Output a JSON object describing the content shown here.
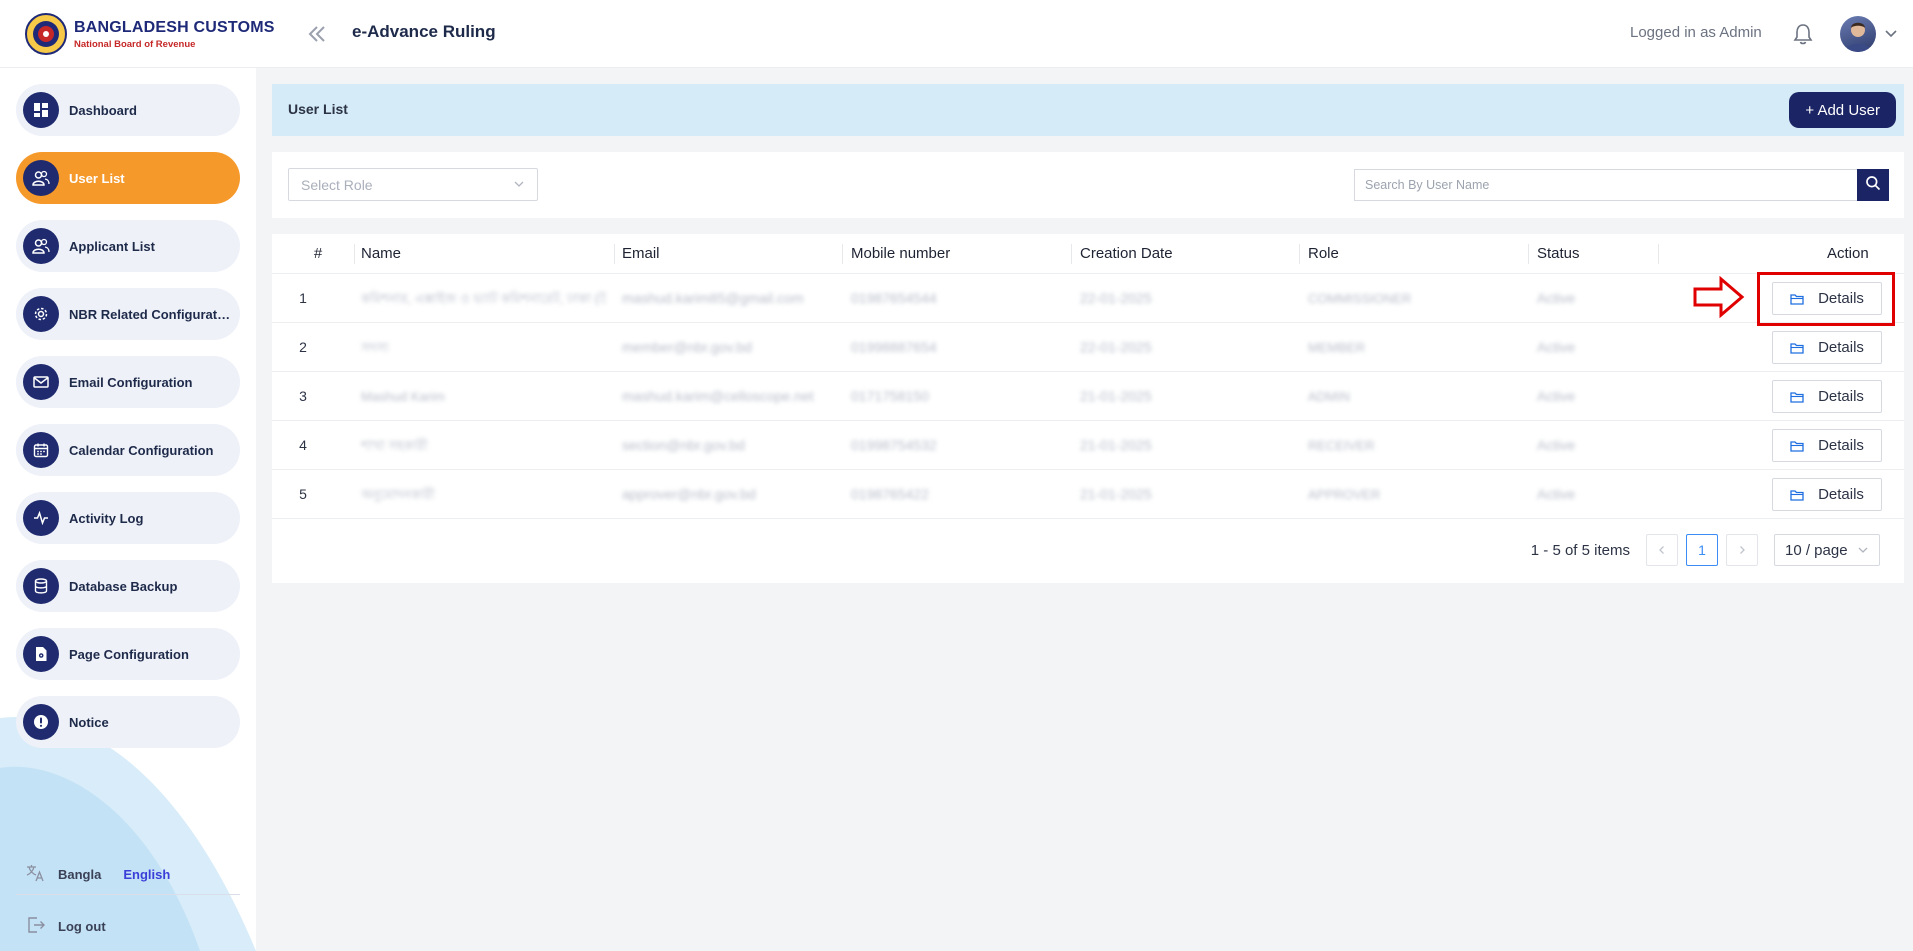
{
  "brand": {
    "title": "BANGLADESH CUSTOMS",
    "subtitle": "National Board of Revenue"
  },
  "header": {
    "app_title": "e-Advance Ruling",
    "logged_in_text": "Logged in as Admin",
    "collapse_icon": "double-chevron-left-icon"
  },
  "sidebar": {
    "items": [
      {
        "label": "Dashboard",
        "icon": "dashboard-icon",
        "active": false
      },
      {
        "label": "User List",
        "icon": "users-icon",
        "active": true
      },
      {
        "label": "Applicant List",
        "icon": "users-icon",
        "active": false
      },
      {
        "label": "NBR Related Configurati...",
        "icon": "gear-icon",
        "active": false
      },
      {
        "label": "Email Configuration",
        "icon": "mail-icon",
        "active": false
      },
      {
        "label": "Calendar Configuration",
        "icon": "calendar-icon",
        "active": false
      },
      {
        "label": "Activity Log",
        "icon": "activity-icon",
        "active": false
      },
      {
        "label": "Database Backup",
        "icon": "database-icon",
        "active": false
      },
      {
        "label": "Page Configuration",
        "icon": "file-gear-icon",
        "active": false
      },
      {
        "label": "Notice",
        "icon": "alert-icon",
        "active": false
      }
    ],
    "lang_bangla": "Bangla",
    "lang_english": "English",
    "logout": "Log out"
  },
  "page": {
    "title": "User List",
    "add_button": "+ Add User"
  },
  "filters": {
    "role_placeholder": "Select Role",
    "search_placeholder": "Search By User Name"
  },
  "table": {
    "columns": [
      "#",
      "Name",
      "Email",
      "Mobile number",
      "Creation Date",
      "Role",
      "Status",
      "Action"
    ],
    "rows": [
      {
        "num": "1",
        "name": "কমিশনার, এক্সাইজ ও ভ্যাট কমিশনারেট, ঢাকা (উ...",
        "email": "mashud.karim85@gmail.com",
        "mobile": "01987654544",
        "date": "22-01-2025",
        "role": "COMMISSIONER",
        "status": "Active",
        "action": "Details"
      },
      {
        "num": "2",
        "name": "সদস্য",
        "email": "member@nbr.gov.bd",
        "mobile": "01998887654",
        "date": "22-01-2025",
        "role": "MEMBER",
        "status": "Active",
        "action": "Details"
      },
      {
        "num": "3",
        "name": "Mashud Karim",
        "email": "mashud.karim@celloscope.net",
        "mobile": "0171758150",
        "date": "21-01-2025",
        "role": "ADMIN",
        "status": "Active",
        "action": "Details"
      },
      {
        "num": "4",
        "name": "শাখা সহকারী",
        "email": "section@nbr.gov.bd",
        "mobile": "01998754532",
        "date": "21-01-2025",
        "role": "RECEIVER",
        "status": "Active",
        "action": "Details"
      },
      {
        "num": "5",
        "name": "অনুমোদনকারী",
        "email": "approver@nbr.gov.bd",
        "mobile": "0198765422",
        "date": "21-01-2025",
        "role": "APPROVER",
        "status": "Active",
        "action": "Details"
      }
    ]
  },
  "pagination": {
    "summary": "1 - 5 of 5 items",
    "current_page": "1",
    "page_size": "10 / page"
  },
  "colors": {
    "brand_navy": "#1b2465",
    "active_orange": "#f5992b",
    "page_header_bg": "#d5ebf8",
    "annotation_red": "#e00000"
  }
}
